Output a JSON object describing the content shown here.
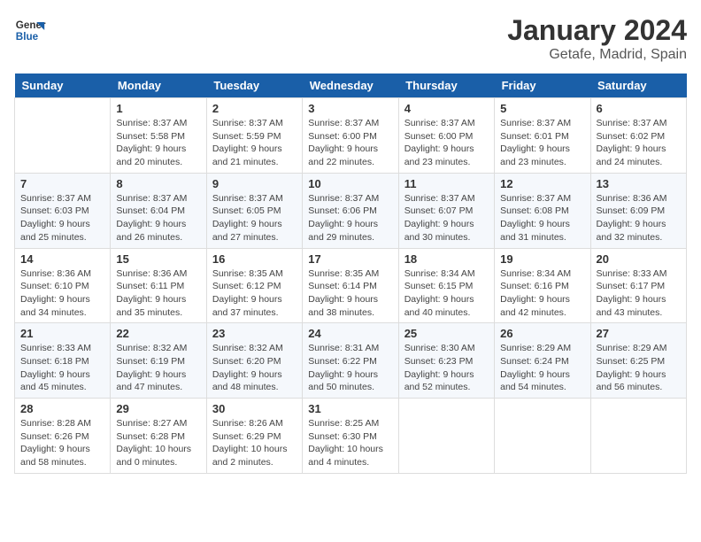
{
  "header": {
    "logo_line1": "General",
    "logo_line2": "Blue",
    "title": "January 2024",
    "subtitle": "Getafe, Madrid, Spain"
  },
  "days_of_week": [
    "Sunday",
    "Monday",
    "Tuesday",
    "Wednesday",
    "Thursday",
    "Friday",
    "Saturday"
  ],
  "weeks": [
    [
      {
        "day": "",
        "sunrise": "",
        "sunset": "",
        "daylight": ""
      },
      {
        "day": "1",
        "sunrise": "Sunrise: 8:37 AM",
        "sunset": "Sunset: 5:58 PM",
        "daylight": "Daylight: 9 hours and 20 minutes."
      },
      {
        "day": "2",
        "sunrise": "Sunrise: 8:37 AM",
        "sunset": "Sunset: 5:59 PM",
        "daylight": "Daylight: 9 hours and 21 minutes."
      },
      {
        "day": "3",
        "sunrise": "Sunrise: 8:37 AM",
        "sunset": "Sunset: 6:00 PM",
        "daylight": "Daylight: 9 hours and 22 minutes."
      },
      {
        "day": "4",
        "sunrise": "Sunrise: 8:37 AM",
        "sunset": "Sunset: 6:00 PM",
        "daylight": "Daylight: 9 hours and 23 minutes."
      },
      {
        "day": "5",
        "sunrise": "Sunrise: 8:37 AM",
        "sunset": "Sunset: 6:01 PM",
        "daylight": "Daylight: 9 hours and 23 minutes."
      },
      {
        "day": "6",
        "sunrise": "Sunrise: 8:37 AM",
        "sunset": "Sunset: 6:02 PM",
        "daylight": "Daylight: 9 hours and 24 minutes."
      }
    ],
    [
      {
        "day": "7",
        "sunrise": "Sunrise: 8:37 AM",
        "sunset": "Sunset: 6:03 PM",
        "daylight": "Daylight: 9 hours and 25 minutes."
      },
      {
        "day": "8",
        "sunrise": "Sunrise: 8:37 AM",
        "sunset": "Sunset: 6:04 PM",
        "daylight": "Daylight: 9 hours and 26 minutes."
      },
      {
        "day": "9",
        "sunrise": "Sunrise: 8:37 AM",
        "sunset": "Sunset: 6:05 PM",
        "daylight": "Daylight: 9 hours and 27 minutes."
      },
      {
        "day": "10",
        "sunrise": "Sunrise: 8:37 AM",
        "sunset": "Sunset: 6:06 PM",
        "daylight": "Daylight: 9 hours and 29 minutes."
      },
      {
        "day": "11",
        "sunrise": "Sunrise: 8:37 AM",
        "sunset": "Sunset: 6:07 PM",
        "daylight": "Daylight: 9 hours and 30 minutes."
      },
      {
        "day": "12",
        "sunrise": "Sunrise: 8:37 AM",
        "sunset": "Sunset: 6:08 PM",
        "daylight": "Daylight: 9 hours and 31 minutes."
      },
      {
        "day": "13",
        "sunrise": "Sunrise: 8:36 AM",
        "sunset": "Sunset: 6:09 PM",
        "daylight": "Daylight: 9 hours and 32 minutes."
      }
    ],
    [
      {
        "day": "14",
        "sunrise": "Sunrise: 8:36 AM",
        "sunset": "Sunset: 6:10 PM",
        "daylight": "Daylight: 9 hours and 34 minutes."
      },
      {
        "day": "15",
        "sunrise": "Sunrise: 8:36 AM",
        "sunset": "Sunset: 6:11 PM",
        "daylight": "Daylight: 9 hours and 35 minutes."
      },
      {
        "day": "16",
        "sunrise": "Sunrise: 8:35 AM",
        "sunset": "Sunset: 6:12 PM",
        "daylight": "Daylight: 9 hours and 37 minutes."
      },
      {
        "day": "17",
        "sunrise": "Sunrise: 8:35 AM",
        "sunset": "Sunset: 6:14 PM",
        "daylight": "Daylight: 9 hours and 38 minutes."
      },
      {
        "day": "18",
        "sunrise": "Sunrise: 8:34 AM",
        "sunset": "Sunset: 6:15 PM",
        "daylight": "Daylight: 9 hours and 40 minutes."
      },
      {
        "day": "19",
        "sunrise": "Sunrise: 8:34 AM",
        "sunset": "Sunset: 6:16 PM",
        "daylight": "Daylight: 9 hours and 42 minutes."
      },
      {
        "day": "20",
        "sunrise": "Sunrise: 8:33 AM",
        "sunset": "Sunset: 6:17 PM",
        "daylight": "Daylight: 9 hours and 43 minutes."
      }
    ],
    [
      {
        "day": "21",
        "sunrise": "Sunrise: 8:33 AM",
        "sunset": "Sunset: 6:18 PM",
        "daylight": "Daylight: 9 hours and 45 minutes."
      },
      {
        "day": "22",
        "sunrise": "Sunrise: 8:32 AM",
        "sunset": "Sunset: 6:19 PM",
        "daylight": "Daylight: 9 hours and 47 minutes."
      },
      {
        "day": "23",
        "sunrise": "Sunrise: 8:32 AM",
        "sunset": "Sunset: 6:20 PM",
        "daylight": "Daylight: 9 hours and 48 minutes."
      },
      {
        "day": "24",
        "sunrise": "Sunrise: 8:31 AM",
        "sunset": "Sunset: 6:22 PM",
        "daylight": "Daylight: 9 hours and 50 minutes."
      },
      {
        "day": "25",
        "sunrise": "Sunrise: 8:30 AM",
        "sunset": "Sunset: 6:23 PM",
        "daylight": "Daylight: 9 hours and 52 minutes."
      },
      {
        "day": "26",
        "sunrise": "Sunrise: 8:29 AM",
        "sunset": "Sunset: 6:24 PM",
        "daylight": "Daylight: 9 hours and 54 minutes."
      },
      {
        "day": "27",
        "sunrise": "Sunrise: 8:29 AM",
        "sunset": "Sunset: 6:25 PM",
        "daylight": "Daylight: 9 hours and 56 minutes."
      }
    ],
    [
      {
        "day": "28",
        "sunrise": "Sunrise: 8:28 AM",
        "sunset": "Sunset: 6:26 PM",
        "daylight": "Daylight: 9 hours and 58 minutes."
      },
      {
        "day": "29",
        "sunrise": "Sunrise: 8:27 AM",
        "sunset": "Sunset: 6:28 PM",
        "daylight": "Daylight: 10 hours and 0 minutes."
      },
      {
        "day": "30",
        "sunrise": "Sunrise: 8:26 AM",
        "sunset": "Sunset: 6:29 PM",
        "daylight": "Daylight: 10 hours and 2 minutes."
      },
      {
        "day": "31",
        "sunrise": "Sunrise: 8:25 AM",
        "sunset": "Sunset: 6:30 PM",
        "daylight": "Daylight: 10 hours and 4 minutes."
      },
      {
        "day": "",
        "sunrise": "",
        "sunset": "",
        "daylight": ""
      },
      {
        "day": "",
        "sunrise": "",
        "sunset": "",
        "daylight": ""
      },
      {
        "day": "",
        "sunrise": "",
        "sunset": "",
        "daylight": ""
      }
    ]
  ]
}
